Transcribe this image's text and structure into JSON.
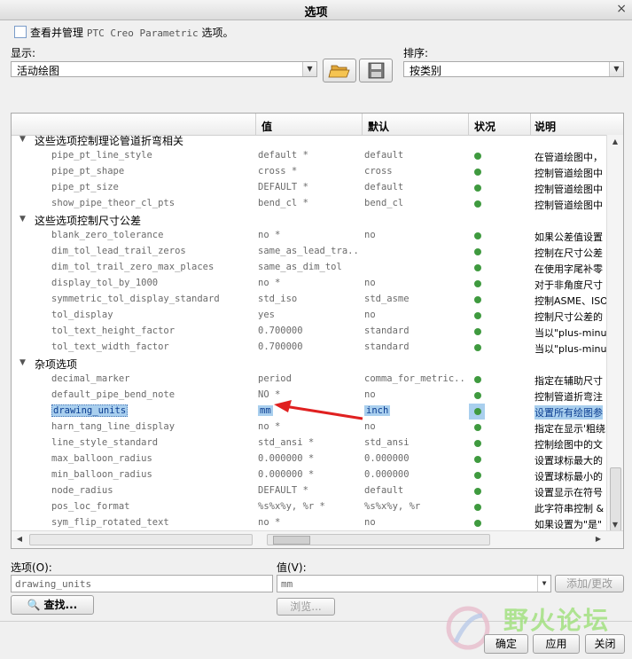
{
  "window": {
    "title": "选项",
    "close": "×"
  },
  "header_check_label": "查看并管理",
  "header_check_mono": "PTC Creo Parametric",
  "header_check_tail": "选项。",
  "display": {
    "label": "显示:",
    "value": "活动绘图"
  },
  "sort": {
    "label": "排序:",
    "value": "按类别"
  },
  "icons": {
    "open": "folder-open-icon",
    "save": "save-icon"
  },
  "columns": {
    "name": "",
    "value": "值",
    "default": "默认",
    "status": "状况",
    "desc": "说明"
  },
  "groups": [
    {
      "title": "这些选项控制理论管道折弯相关"
    },
    {
      "title": "这些选项控制尺寸公差"
    },
    {
      "title": "杂项选项"
    }
  ],
  "rows_g1": [
    {
      "name": "pipe_pt_line_style",
      "value": "default *",
      "default": "default",
      "desc": "在管道绘图中，"
    },
    {
      "name": "pipe_pt_shape",
      "value": "cross *",
      "default": "cross",
      "desc": "控制管道绘图中"
    },
    {
      "name": "pipe_pt_size",
      "value": "DEFAULT *",
      "default": "default",
      "desc": "控制管道绘图中"
    },
    {
      "name": "show_pipe_theor_cl_pts",
      "value": "bend_cl *",
      "default": "bend_cl",
      "desc": "控制管道绘图中"
    }
  ],
  "rows_g2": [
    {
      "name": "blank_zero_tolerance",
      "value": "no *",
      "default": "no",
      "desc": "如果公差值设置"
    },
    {
      "name": "dim_tol_lead_trail_zeros",
      "value": "same_as_lead_tra...",
      "default": "",
      "desc": "控制在尺寸公差"
    },
    {
      "name": "dim_tol_trail_zero_max_places",
      "value": "same_as_dim_tol",
      "default": "",
      "desc": "在使用字尾补零"
    },
    {
      "name": "display_tol_by_1000",
      "value": "no *",
      "default": "no",
      "desc": "对于非角度尺寸"
    },
    {
      "name": "symmetric_tol_display_standard",
      "value": "std_iso",
      "default": "std_asme",
      "desc": "控制ASME、ISO及"
    },
    {
      "name": "tol_display",
      "value": "yes",
      "default": "no",
      "desc": "控制尺寸公差的"
    },
    {
      "name": "tol_text_height_factor",
      "value": "0.700000",
      "default": "standard",
      "desc": "当以\"plus-minu"
    },
    {
      "name": "tol_text_width_factor",
      "value": "0.700000",
      "default": "standard",
      "desc": "当以\"plus-minu"
    }
  ],
  "rows_g3": [
    {
      "name": "decimal_marker",
      "value": "period",
      "default": "comma_for_metric...",
      "desc": "指定在辅助尺寸"
    },
    {
      "name": "default_pipe_bend_note",
      "value": "NO *",
      "default": "no",
      "desc": "控制管道折弯注"
    },
    {
      "name": "drawing_units",
      "value": "mm",
      "default": "inch",
      "desc": "设置所有绘图参"
    },
    {
      "name": "harn_tang_line_display",
      "value": "no *",
      "default": "no",
      "desc": "指定在显示'粗绕"
    },
    {
      "name": "line_style_standard",
      "value": "std_ansi *",
      "default": "std_ansi",
      "desc": "控制绘图中的文"
    },
    {
      "name": "max_balloon_radius",
      "value": "0.000000 *",
      "default": "0.000000",
      "desc": "设置球标最大的"
    },
    {
      "name": "min_balloon_radius",
      "value": "0.000000 *",
      "default": "0.000000",
      "desc": "设置球标最小的"
    },
    {
      "name": "node_radius",
      "value": "DEFAULT *",
      "default": "default",
      "desc": "设置显示在符号"
    },
    {
      "name": "pos_loc_format",
      "value": "%s%x%y, %r *",
      "default": "%s%x%y, %r",
      "desc": "此字符串控制 &"
    },
    {
      "name": "sym_flip_rotated_text",
      "value": "no *",
      "default": "no",
      "desc": "如果设置为\"是\""
    }
  ],
  "bottom": {
    "option_label": "选项(O):",
    "option_value": "drawing_units",
    "value_label": "值(V):",
    "value_value": "mm",
    "add_change": "添加/更改",
    "find": "查找...",
    "browse": "浏览..."
  },
  "footer": {
    "ok": "确定",
    "apply": "应用",
    "close": "关闭"
  },
  "watermark": {
    "text": "野火论坛"
  },
  "colors": {
    "status_ok": "#3f9a3f",
    "selection": "#a9cfee",
    "arrow": "#e02020"
  }
}
